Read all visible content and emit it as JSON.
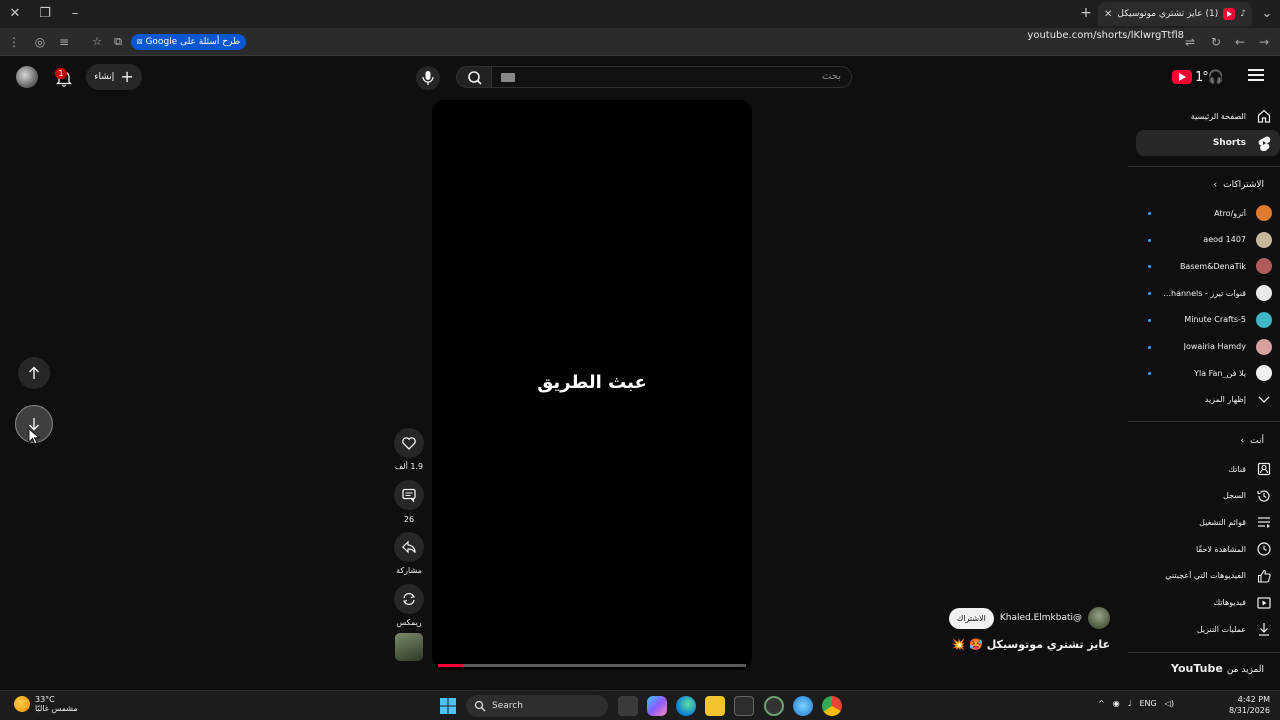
{
  "browser": {
    "tab_title": "(1) عايز تشتري موتوسيكل 🥵",
    "url": "youtube.com/shorts/lKlwrgTtfl8",
    "gemini_label": "طرح أسئلة على Google"
  },
  "masthead": {
    "search_placeholder": "بحث",
    "create_label": "إنشاء",
    "notification_count": "1"
  },
  "player": {
    "overlay_text": "عبث الطريق",
    "progress": 0.08,
    "channel_handle": "@Khaled.Elmkbati",
    "subscribe_label": "الاشتراك",
    "video_title": "عايز تشتري موتوسيكل 🥵 💥"
  },
  "actions": {
    "like_count": "1.9 ألف",
    "comment_count": "26",
    "share_label": "مشاركة",
    "remix_label": "ريمكس"
  },
  "sidebar": {
    "home": "الصفحة الرئيسية",
    "shorts": "Shorts",
    "subscriptions_header": "الاشتراكات",
    "subscriptions": [
      {
        "name": "أترو/Atro",
        "color": "#e07a2f"
      },
      {
        "name": "aeod 1407",
        "color": "#c9b89a"
      },
      {
        "name": "Basem&DenaTik",
        "color": "#b05a5a"
      },
      {
        "name": "قنوات تيرز - hannels...",
        "color": "#e9e9e9"
      },
      {
        "name": "5-Minute Crafts",
        "color": "#3fb6c7"
      },
      {
        "name": "Jowairia Hamdy",
        "color": "#d9a0a0"
      },
      {
        "name": "يلا فن_Yla Fan",
        "color": "#f2f2f2"
      }
    ],
    "show_more": "إظهار المزيد",
    "you_header": "أنت",
    "you_items": [
      {
        "label": "قناتك",
        "icon": "channel-icon"
      },
      {
        "label": "السجل",
        "icon": "history-icon"
      },
      {
        "label": "قوائم التشغيل",
        "icon": "playlists-icon"
      },
      {
        "label": "المشاهدة لاحقًا",
        "icon": "watch-later-icon"
      },
      {
        "label": "الفيديوهات التي أعجبتني",
        "icon": "liked-icon"
      },
      {
        "label": "فيديوهاتك",
        "icon": "your-videos-icon"
      },
      {
        "label": "عمليات التنزيل",
        "icon": "downloads-icon"
      }
    ],
    "more_from": "المزيد من",
    "more_from_brand": "YouTube"
  },
  "taskbar": {
    "temperature": "33°C",
    "weather_desc": "مشمس غالبًا",
    "search_label": "Search",
    "lang": "ENG",
    "time": "4:42 PM",
    "date": "8/31/2026"
  },
  "colors": {
    "accent_red": "#ff0033",
    "background": "#0f0f0f",
    "chip": "#272727",
    "link_blue": "#3ea6ff"
  }
}
